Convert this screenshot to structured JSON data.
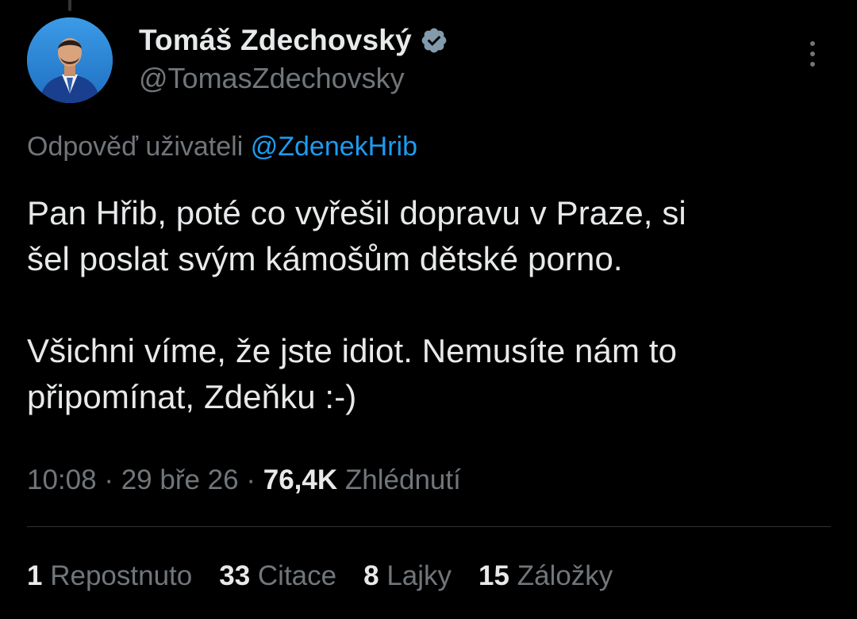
{
  "author": {
    "display_name": "Tomáš Zdechovský",
    "handle": "@TomasZdechovsky",
    "verified": true
  },
  "reply_context": {
    "prefix": "Odpověď uživateli ",
    "mention": "@ZdenekHrib"
  },
  "tweet": {
    "lines": [
      "Pan Hřib, poté co vyřešil dopravu v Praze, si",
      "šel poslat svým kámošům dětské porno.",
      "Všichni víme, že jste idiot. Nemusíte nám to",
      "připomínat, Zdeňku :-)"
    ]
  },
  "meta": {
    "time": "10:08",
    "separator": "·",
    "date": "29 bře 26",
    "views_count": "76,4K",
    "views_label": "Zhlédnutí"
  },
  "stats": [
    {
      "count": "1",
      "label": "Repostnuto"
    },
    {
      "count": "33",
      "label": "Citace"
    },
    {
      "count": "8",
      "label": "Lajky"
    },
    {
      "count": "15",
      "label": "Záložky"
    }
  ],
  "colors": {
    "background": "#000000",
    "text_primary": "#e7e9ea",
    "text_secondary": "#71767b",
    "accent": "#1d9bf0",
    "divider": "#2f3336"
  },
  "icons": {
    "verified": "verified-badge-icon",
    "more": "more-options-icon"
  }
}
